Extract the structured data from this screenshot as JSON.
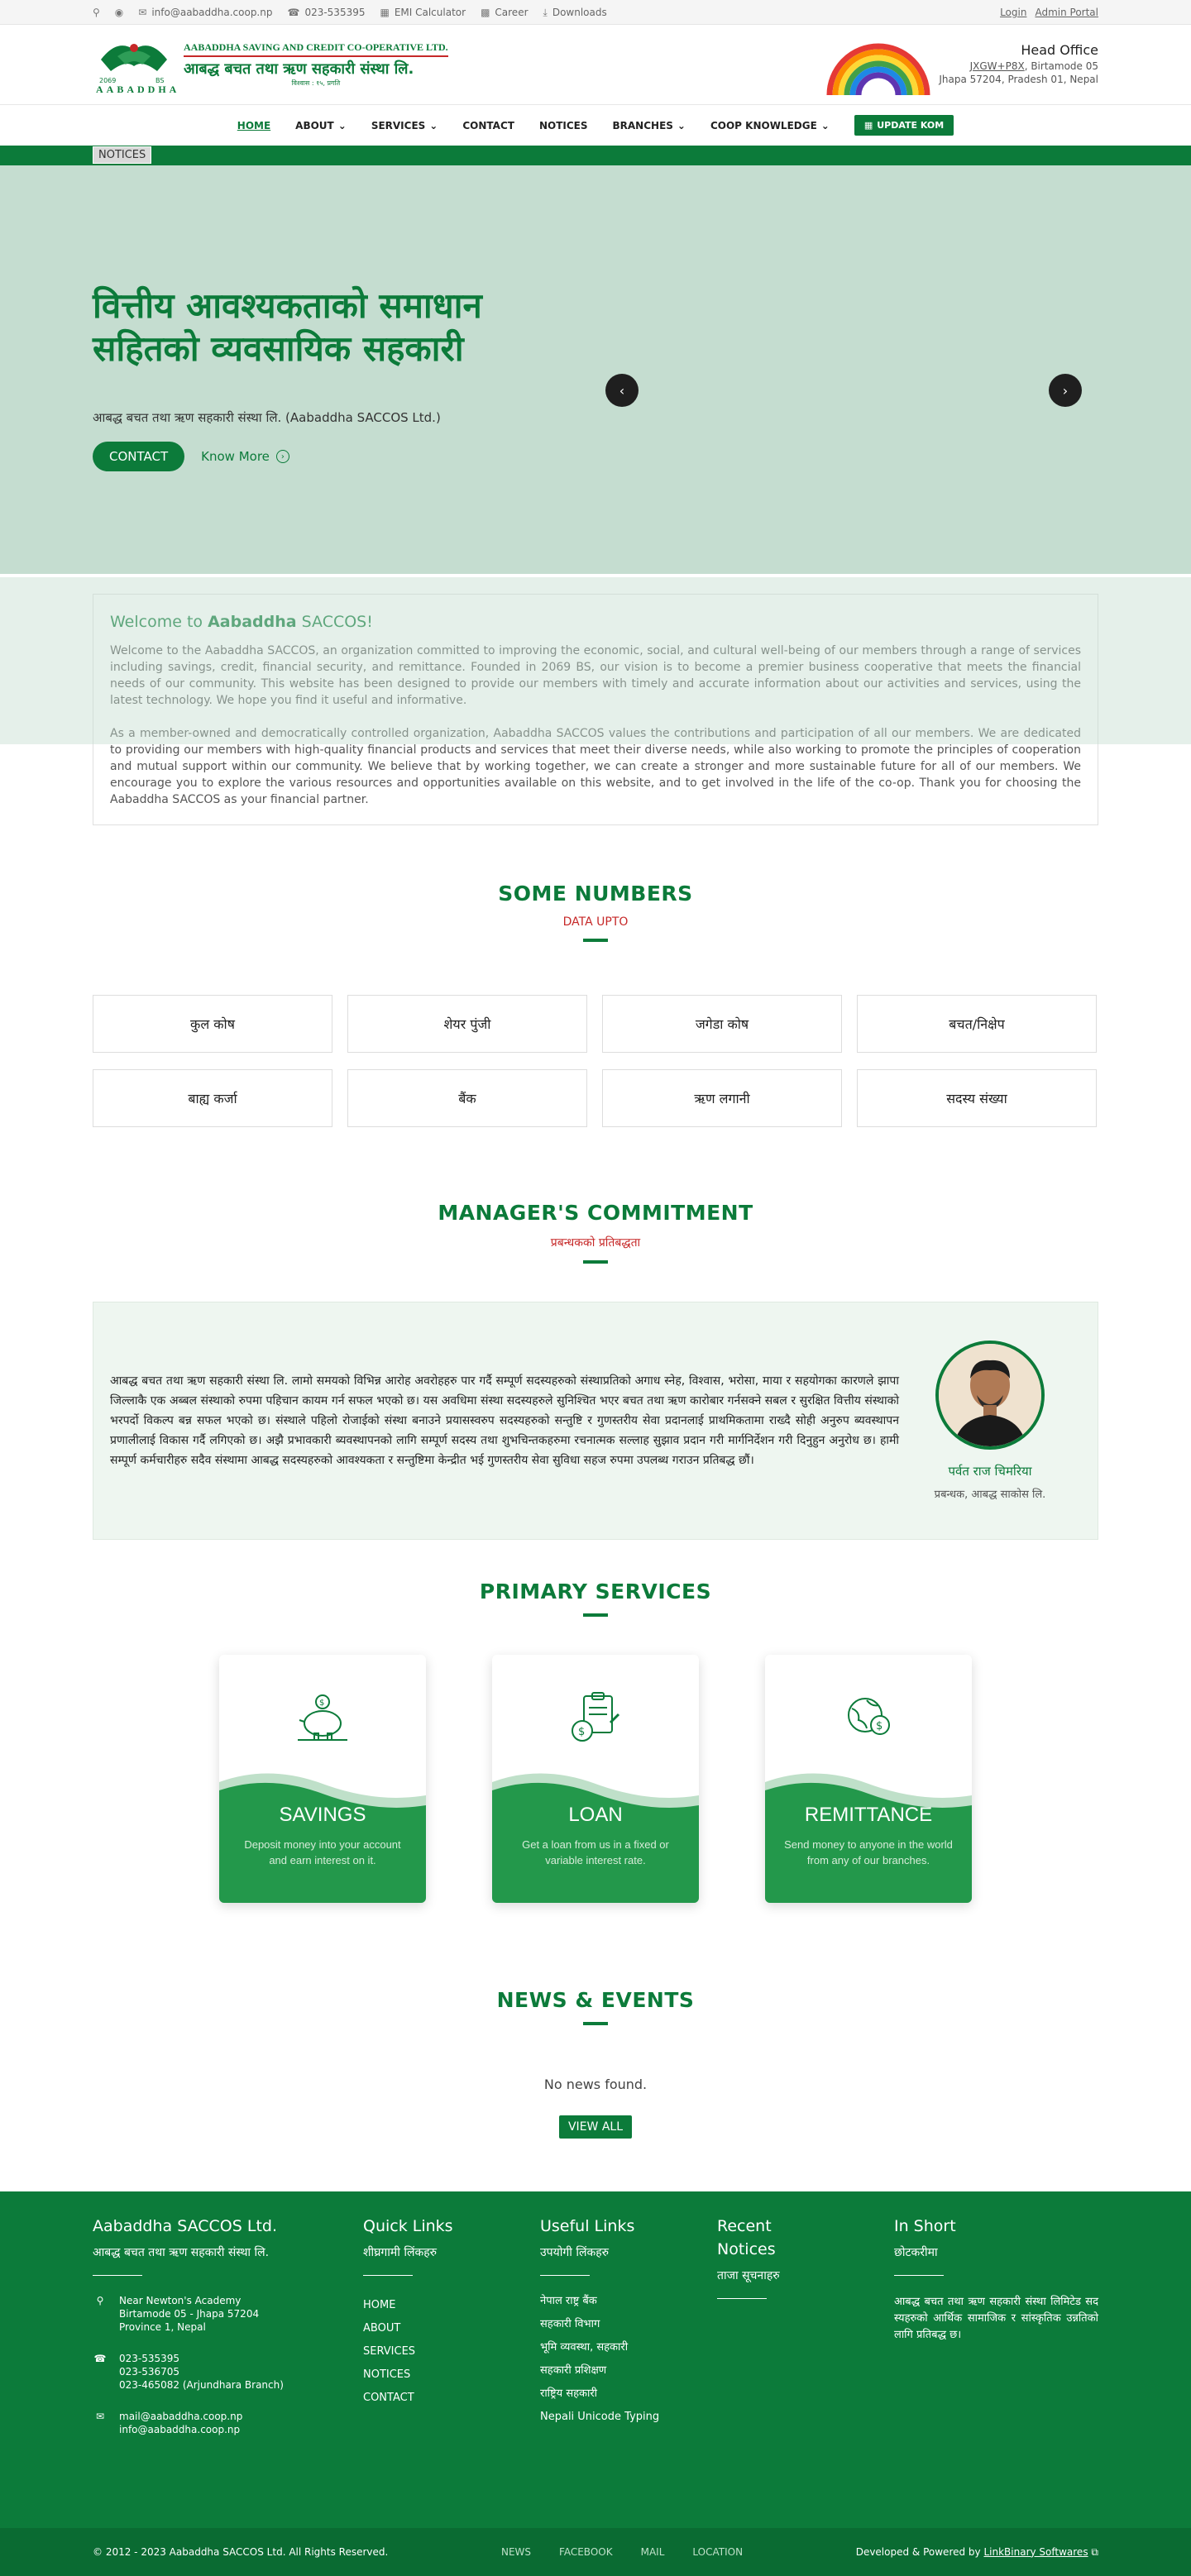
{
  "topbar": {
    "email": "info@aabaddha.coop.np",
    "phone": "023-535395",
    "emi": "EMI Calculator",
    "career": "Career",
    "downloads": "Downloads",
    "login": "Login",
    "admin": "Admin Portal"
  },
  "brand": {
    "name_en": "AABADDHA SAVING AND CREDIT CO-OPERATIVE LTD.",
    "name_np": "आबद्ध बचत तथा ऋण सहकारी संस्था लि.",
    "tag": "विश्वास : १५, प्रगति",
    "logo_word": "AABADDHA"
  },
  "head_office": {
    "title": "Head Office",
    "line1_link": "JXGW+P8X",
    "line1_rest": ", Birtamode 05",
    "line2": "Jhapa 57204, Pradesh 01, Nepal"
  },
  "nav": {
    "home": "HOME",
    "about": "ABOUT",
    "services": "SERVICES",
    "contact": "CONTACT",
    "notices": "NOTICES",
    "branches": "BRANCHES",
    "coop": "COOP KNOWLEDGE",
    "update": "UPDATE KOM"
  },
  "notice_label": "NOTICES",
  "hero": {
    "title": "वित्तीय आवश्यकताको समाधान सहितको व्यवसायिक सहकारी",
    "subtitle": "आबद्ध बचत तथा ऋण सहकारी संस्था लि. (Aabaddha SACCOS Ltd.)",
    "contact": "CONTACT",
    "know_more": "Know More"
  },
  "welcome": {
    "title_pre": "Welcome to ",
    "title_bold": "Aabaddha",
    "title_post": " SACCOS!",
    "p1": "Welcome to the Aabaddha SACCOS, an organization committed to improving the economic, social, and cultural well-being of our members through a range of services including savings, credit, financial security, and remittance. Founded in 2069 BS, our vision is to become a premier business cooperative that meets the financial needs of our community. This website has been designed to provide our members with timely and accurate information about our activities and services, using the latest technology. We hope you find it useful and informative.",
    "p2": "As a member-owned and democratically controlled organization, Aabaddha SACCOS values the contributions and participation of all our members. We are dedicated to providing our members with high-quality financial products and services that meet their diverse needs, while also working to promote the principles of cooperation and mutual support within our community. We believe that by working together, we can create a stronger and more sustainable future for all of our members. We encourage you to explore the various resources and opportunities available on this website, and to get involved in the life of the co-op. Thank you for choosing the Aabaddha SACCOS as your financial partner."
  },
  "numbers": {
    "title": "SOME NUMBERS",
    "sub": "DATA UPTO",
    "items": [
      "कुल कोष",
      "शेयर पुंजी",
      "जगेडा कोष",
      "बचत/निक्षेप",
      "बाह्य कर्जा",
      "बैंक",
      "ऋण लगानी",
      "सदस्य संख्या"
    ]
  },
  "manager": {
    "title": "MANAGER'S COMMITMENT",
    "sub": "प्रबन्धकको प्रतिबद्धता",
    "text": "आबद्ध बचत तथा ऋण सहकारी संस्था लि. लामो समयको विभिन्न आरोह अवरोहहरु पार गर्दै सम्पूर्ण सदस्यहरुको संस्थाप्रतिको अगाध स्नेह, विश्वास, भरोसा, माया र सहयोगका कारणले झापा जिल्लाकै एक अब्बल संस्थाको रुपमा पहिचान कायम गर्न सफल भएको छ। यस अवधिमा संस्था सदस्यहरुले सुनिश्चित भएर बचत तथा ऋण कारोबार गर्नसक्ने सबल र सुरक्षित वित्तीय संस्थाको भरपर्दो विकल्प बन्न सफल भएको छ। संस्थाले पहिलो रोजाईको संस्था बनाउने प्रयासस्वरुप सदस्यहरुको सन्तुष्टि र गुणस्तरीय सेवा प्रदानलाई प्राथमिकतामा राख्दै सोही अनुरुप ब्यवस्थापन प्रणालीलाई विकास गर्दै लगिएको छ। अझै प्रभावकारी ब्यवस्थापनको लागि सम्पूर्ण सदस्य तथा शुभचिन्तकहरुमा रचनात्मक सल्लाह सुझाव प्रदान गरी मार्गनिर्देशन गरी दिनुहुन अनुरोध छ। हामी सम्पूर्ण कर्मचारीहरु सदैव संस्थामा आबद्ध सदस्यहरुको आवश्यकता र सन्तुष्टिमा केन्द्रीत भई गुणस्तरीय सेवा सुविधा सहज रुपमा उपलब्ध गराउन प्रतिबद्ध छौं।",
    "name": "पर्वत राज चिमरिया",
    "role": "प्रबन्धक, आबद्ध साकोस लि."
  },
  "services": {
    "title": "PRIMARY SERVICES",
    "items": [
      {
        "name": "SAVINGS",
        "desc": "Deposit money into your account and earn interest on it.",
        "icon": "piggy-bank-icon"
      },
      {
        "name": "LOAN",
        "desc": "Get a loan from us in a fixed or variable interest rate.",
        "icon": "loan-clipboard-icon"
      },
      {
        "name": "REMITTANCE",
        "desc": "Send money to anyone in the world from any of our branches.",
        "icon": "globe-money-icon"
      }
    ]
  },
  "news": {
    "title": "NEWS & EVENTS",
    "empty": "No news found.",
    "view_all": "VIEW ALL"
  },
  "footer": {
    "col1": {
      "title": "Aabaddha SACCOS Ltd.",
      "sub": "आबद्ध बचत तथा ऋण सहकारी संस्था लि.",
      "addr1": "Near Newton's Academy",
      "addr2": "Birtamode 05 - Jhapa 57204",
      "addr3": "Province 1, Nepal",
      "ph1": "023-535395",
      "ph2": "023-536705",
      "ph3": "023-465082 (Arjundhara Branch)",
      "mail1": "mail@aabaddha.coop.np",
      "mail2": "info@aabaddha.coop.np"
    },
    "col2": {
      "title": "Quick Links",
      "sub": "शीघ्रगामी लिंकहरु",
      "links": [
        "HOME",
        "ABOUT",
        "SERVICES",
        "NOTICES",
        "CONTACT"
      ]
    },
    "col3": {
      "title": "Useful Links",
      "sub": "उपयोगी लिंकहरु",
      "links": [
        "नेपाल राष्ट्र बैंक",
        "सहकारी विभाग",
        "भूमि व्यवस्था, सहकारी",
        "सहकारी प्रशिक्षण",
        "राष्ट्रिय सहकारी",
        "Nepali Unicode Typing"
      ]
    },
    "col4": {
      "title": "Recent Notices",
      "sub": "ताजा सूचनाहरु"
    },
    "col5": {
      "title": "In Short",
      "sub": "छोटकरीमा",
      "text": "आबद्ध बचत तथा ऋण सहकारी संस्था लिमिटेड सदस्यहरुको आर्थिक सामाजिक र सांस्कृतिक उन्नतिको लागि प्रतिबद्ध छ।"
    },
    "copyright": "© 2012 - 2023 Aabaddha SACCOS Ltd. All Rights Reserved.",
    "bottom_links": [
      "NEWS",
      "FACEBOOK",
      "MAIL",
      "LOCATION"
    ],
    "dev_pre": "Developed & Powered by ",
    "dev_link": "LinkBinary Softwares"
  },
  "colors": {
    "brand": "#0c7b3a",
    "accent_red": "#c62828",
    "hero_bg": "#c5ddd0"
  }
}
